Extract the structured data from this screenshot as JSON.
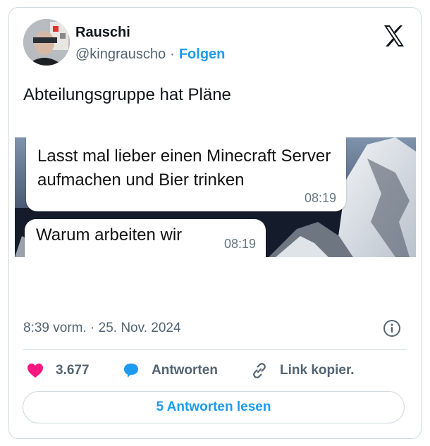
{
  "author": {
    "name": "Rauschi",
    "handle": "@kingrauscho",
    "separator": "·",
    "follow_label": "Folgen"
  },
  "tweet": {
    "text": "Abteilungsgruppe hat Pläne"
  },
  "media": {
    "messages": [
      {
        "text": "Lasst mal lieber einen Minecraft Server aufmachen und Bier trinken",
        "time": "08:19"
      },
      {
        "text": "Warum arbeiten wir",
        "time": "08:19"
      }
    ]
  },
  "meta": {
    "timestamp": "8:39 vorm. · 25. Nov. 2024"
  },
  "actions": {
    "likes": "3.677",
    "reply_label": "Antworten",
    "copy_label": "Link kopier."
  },
  "read_replies_label": "5 Antworten lesen",
  "icons": {
    "logo": "x-logo-icon",
    "info": "info-icon",
    "like": "heart-icon",
    "reply": "speech-bubble-icon",
    "copy": "link-icon"
  },
  "colors": {
    "accent": "#1d9bf0",
    "like": "#f91880",
    "muted": "#536471",
    "border": "#cfd9de"
  }
}
